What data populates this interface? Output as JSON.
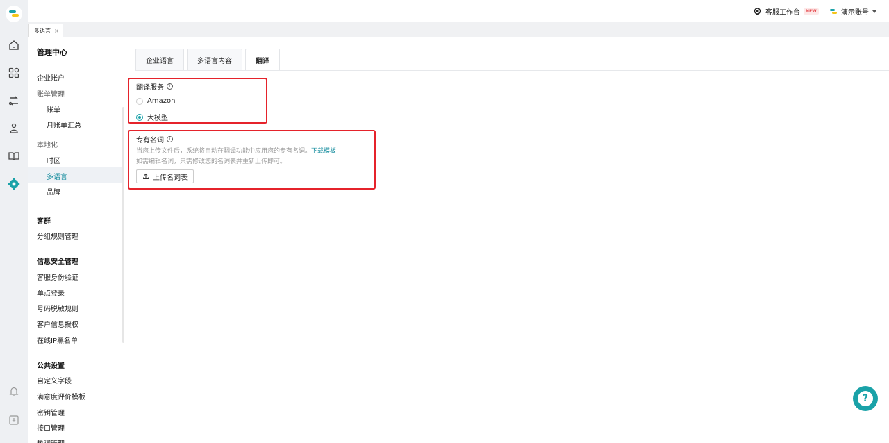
{
  "topbar": {
    "workbench_label": "客服工作台",
    "new_badge": "NEW",
    "account_label": "演示账号"
  },
  "page_tab": {
    "label": "多语言",
    "close": "×"
  },
  "sidebar": {
    "title": "管理中心",
    "items": [
      {
        "label": "企业账户"
      },
      {
        "label": "账单管理"
      },
      {
        "label": "账单"
      },
      {
        "label": "月账单汇总"
      },
      {
        "label": "本地化"
      },
      {
        "label": "时区"
      },
      {
        "label": "多语言"
      },
      {
        "label": "品牌"
      },
      {
        "label": "客群"
      },
      {
        "label": "分组规则管理"
      },
      {
        "label": "信息安全管理"
      },
      {
        "label": "客服身份验证"
      },
      {
        "label": "单点登录"
      },
      {
        "label": "号码脱敏规则"
      },
      {
        "label": "客户信息授权"
      },
      {
        "label": "在线IP黑名单"
      },
      {
        "label": "公共设置"
      },
      {
        "label": "自定义字段"
      },
      {
        "label": "满意度评价模板"
      },
      {
        "label": "密钥管理"
      },
      {
        "label": "接口管理"
      },
      {
        "label": "热词管理"
      }
    ]
  },
  "tabs": [
    {
      "label": "企业语言"
    },
    {
      "label": "多语言内容"
    },
    {
      "label": "翻译",
      "active": true
    }
  ],
  "translation_service": {
    "title": "翻译服务",
    "options": [
      {
        "label": "Amazon",
        "selected": false
      },
      {
        "label": "大模型",
        "selected": true
      }
    ]
  },
  "glossary": {
    "title": "专有名词",
    "desc_line1": "当您上传文件后，系统将自动在翻译功能中应用您的专有名词。",
    "download_link": "下载模板",
    "desc_line2": "如需编辑名词，只需修改您的名词表并重新上传即可。",
    "upload_label": "上传名词表"
  },
  "help": {
    "symbol": "?"
  },
  "colors": {
    "accent": "#1aa2a8",
    "highlight_box": "#e5232b"
  }
}
